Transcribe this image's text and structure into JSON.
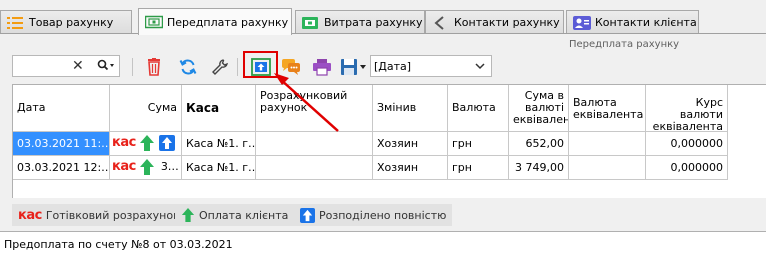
{
  "tabs": [
    {
      "label": "Товар рахунку",
      "icon": "list-icon"
    },
    {
      "label": "Передплата рахунку",
      "icon": "money-icon"
    },
    {
      "label": "Витрата рахунку",
      "icon": "expense-icon"
    },
    {
      "label": "Контакти рахунку",
      "icon": "phone-icon"
    },
    {
      "label": "Контакти клієнта",
      "icon": "contacts-icon"
    }
  ],
  "subtitle": "Передплата рахунку",
  "toolbar": {
    "search_value": "",
    "date_select": "[Дата]"
  },
  "grid": {
    "columns": [
      {
        "label": "Дата"
      },
      {
        "label": "Сума"
      },
      {
        "label": "Каса"
      },
      {
        "label": "Розрахунковий рахунок"
      },
      {
        "label": "Змінив"
      },
      {
        "label": "Валюта"
      },
      {
        "label": "Сума в валюті еквівалента"
      },
      {
        "label": "Валюта еквівалента"
      },
      {
        "label": "Курс валюти еквівалента"
      }
    ],
    "rows": [
      {
        "date": "03.03.2021 11:…",
        "kas": "кас",
        "sum": "",
        "kasa": "Каса №1. г…",
        "account": "",
        "changed_by": "Хозяин",
        "currency": "грн",
        "sum_equiv": "652,00",
        "currency_equiv": "",
        "rate": "0,000000"
      },
      {
        "date": "03.03.2021 12:…",
        "kas": "кас",
        "sum": "3…",
        "kasa": "Каса №1. г…",
        "account": "",
        "changed_by": "Хозяин",
        "currency": "грн",
        "sum_equiv": "3 749,00",
        "currency_equiv": "",
        "rate": "0,000000"
      }
    ]
  },
  "legend": [
    {
      "prefix": "кас",
      "label": "Готівковий розрахунок"
    },
    {
      "label": "Оплата клієнта"
    },
    {
      "label": "Розподілено повністю"
    }
  ],
  "note": "Предоплата по счету №8 от 03.03.2021",
  "colors": {
    "selected_row": "#3390ff",
    "highlight": "#e00000",
    "kas_red": "#e8221b",
    "green": "#2cb45a",
    "blue": "#1a73e8"
  }
}
